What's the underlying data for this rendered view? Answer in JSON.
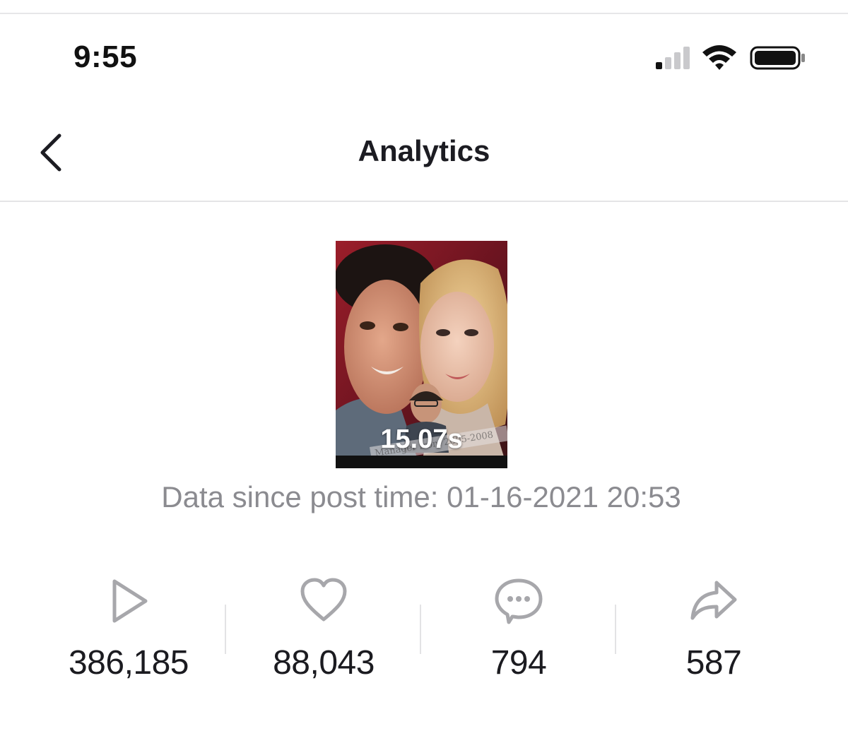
{
  "status_bar": {
    "time": "9:55",
    "icons": [
      "signal-icon",
      "wifi-icon",
      "battery-icon"
    ]
  },
  "header": {
    "title": "Analytics",
    "back_icon": "chevron-left-icon"
  },
  "video": {
    "duration": "15.07s",
    "sticker_text": "Manager from 2005-2008"
  },
  "post_time": "Data since post time: 01-16-2021 20:53",
  "stats": [
    {
      "name": "views",
      "icon": "play-icon",
      "value": "386,185"
    },
    {
      "name": "likes",
      "icon": "heart-icon",
      "value": "88,043"
    },
    {
      "name": "comments",
      "icon": "comment-icon",
      "value": "794"
    },
    {
      "name": "shares",
      "icon": "share-icon",
      "value": "587"
    }
  ],
  "colors": {
    "text_primary": "#1f1f24",
    "text_secondary": "#8b8b90",
    "icon_gray": "#a7a7ab",
    "divider": "#e4e4e6"
  }
}
